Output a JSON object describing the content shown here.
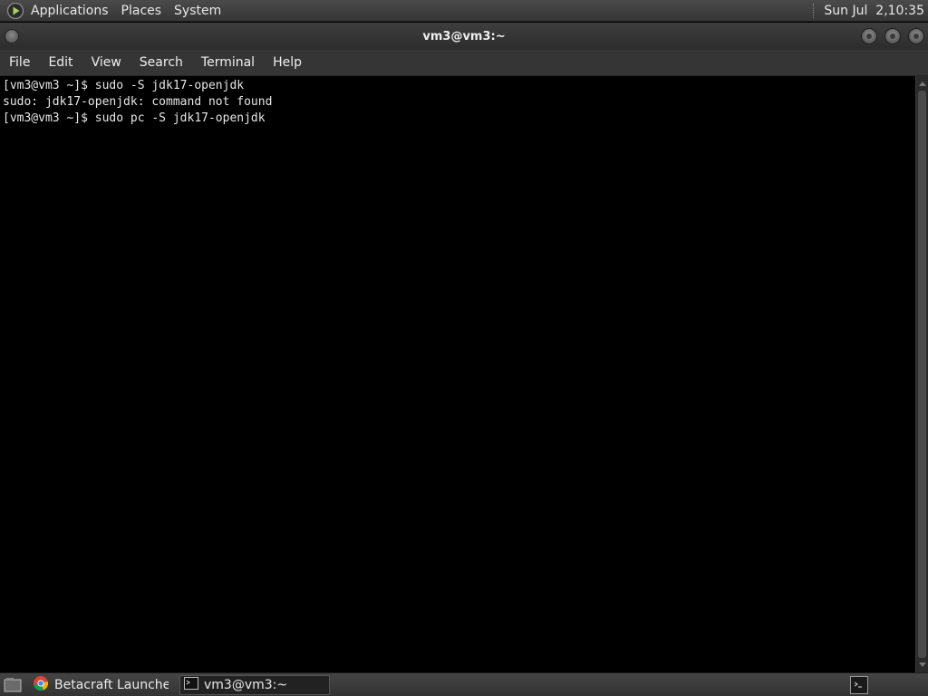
{
  "top_panel": {
    "menus": [
      "Applications",
      "Places",
      "System"
    ],
    "clock": "Sun Jul  2,10:35"
  },
  "window": {
    "title": "vm3@vm3:~"
  },
  "menubar": {
    "items": [
      "File",
      "Edit",
      "View",
      "Search",
      "Terminal",
      "Help"
    ]
  },
  "terminal": {
    "lines": [
      "[vm3@vm3 ~]$ sudo -S jdk17-openjdk",
      "sudo: jdk17-openjdk: command not found",
      "[vm3@vm3 ~]$ sudo pc -S jdk17-openjdk"
    ]
  },
  "taskbar": {
    "tasks": [
      {
        "label": "Betacraft Launcher,J...",
        "icon": "chrome-icon",
        "active": false
      },
      {
        "label": "vm3@vm3:~",
        "icon": "terminal-icon",
        "active": true
      }
    ]
  },
  "colors": {
    "terminal_bg": "#000000",
    "terminal_fg": "#e6e6e6",
    "panel_bg": "#3c3c3c"
  }
}
